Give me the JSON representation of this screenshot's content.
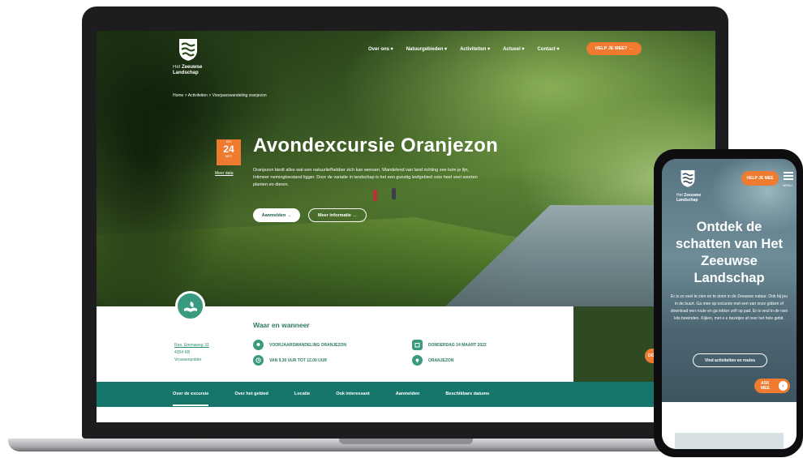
{
  "site": {
    "logo_small": "Het",
    "logo_name_line1": "Zeeuwse",
    "logo_name_line2": "Landschap"
  },
  "nav": {
    "items": [
      "Over ons ▾",
      "Natuurgebieden ▾",
      "Activiteiten ▾",
      "Actueel ▾",
      "Contact ▾"
    ],
    "help_button": "HELP JE MEE? →"
  },
  "breadcrumb": "Home  >  Activiteiten  >  Voorjaarswandeling oranjezon",
  "event": {
    "date_prefix": "DO",
    "day": "24",
    "month": "MRT",
    "other_dates": "Meer data",
    "title": "Avondexcursie Oranjezon",
    "description": "Oranjezon biedt alles wat een natuurliefhebber zich kan wensen. Wandelend van land richting zee kom je lijn, Intimeer nemingtoestand ligger. Door de variatie in landschap is het een gunstig leefgebied voor heel veel soorten planten en dieren.",
    "primary_button": "Aanmelden →",
    "secondary_button": "Meer informatie →"
  },
  "info": {
    "address_lines": [
      "Roo. Emmaweg 33",
      "4354 KB",
      "Vrouwenpolder"
    ],
    "heading": "Waar en wanneer",
    "meta": {
      "type": "VOORJAARSWANDELING ORANJEZON",
      "date": "DONDERDAG 24 MAART 2022",
      "time": "VAN 9.30 UUR TOT 12.00 UUR",
      "location": "ORANJEZON"
    }
  },
  "tabs": [
    "Over de excursie",
    "Over het gebied",
    "Locatie",
    "Ook interessant",
    "Aanmelden",
    "Beschikbare datums"
  ],
  "floating_button": "DO",
  "phone": {
    "help_button": "HELP JE MEE",
    "menu_label": "MENU",
    "title": "Ontdek de schatten van Het Zeeuwse Landschap",
    "description": "Er is zo veel te zien en te doen in de Zeeuwse natuur. Ook bij jou in de buurt. Ga mee op excursie met een van onze gidsen of download een route en ga lekker zelf op pad. Er is veul in de rare kits bewinden. Kijken, met e e bezetjes af over het hele gebit.",
    "button": "Vind activiteiten en routes",
    "ask_button": "ASK MEE"
  },
  "colors": {
    "brand_green": "#17766b",
    "accent_orange": "#ee7b2f",
    "icon_teal": "#3a9a80"
  }
}
